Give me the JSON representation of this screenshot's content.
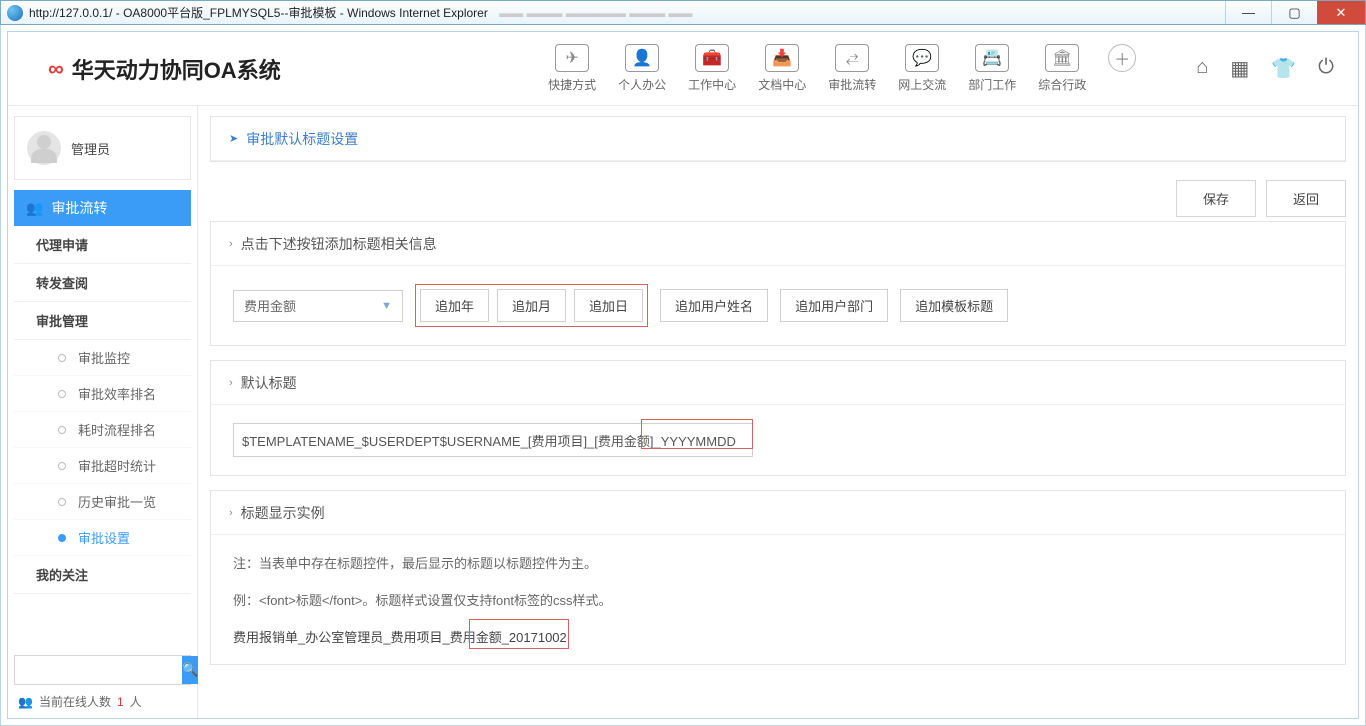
{
  "window": {
    "url": "http://127.0.0.1/",
    "title_suffix": " - OA8000平台版_FPLMYSQL5--审批模板 - Windows Internet Explorer"
  },
  "brand": {
    "name": "华天动力协同OA系统"
  },
  "nav": [
    {
      "label": "快捷方式",
      "glyph": "✈"
    },
    {
      "label": "个人办公",
      "glyph": "👤"
    },
    {
      "label": "工作中心",
      "glyph": "🧰"
    },
    {
      "label": "文档中心",
      "glyph": "📥"
    },
    {
      "label": "审批流转",
      "glyph": "⥄"
    },
    {
      "label": "网上交流",
      "glyph": "💬"
    },
    {
      "label": "部门工作",
      "glyph": "📇"
    },
    {
      "label": "综合行政",
      "glyph": "🏛"
    }
  ],
  "sidebar": {
    "user": "管理员",
    "head": "审批流转",
    "links": [
      "代理申请",
      "转发查阅",
      "审批管理"
    ],
    "subs": [
      "审批监控",
      "审批效率排名",
      "耗时流程排名",
      "审批超时统计",
      "历史审批一览",
      "审批设置"
    ],
    "active_sub_index": 5,
    "concern": "我的关注",
    "online_label": "当前在线人数 ",
    "online_count": "1",
    "online_unit": "人"
  },
  "main": {
    "page_title": "审批默认标题设置",
    "buttons": {
      "save": "保存",
      "back": "返回"
    },
    "section_add": "点击下述按钮添加标题相关信息",
    "select_value": "费用金额",
    "add_btns": [
      "追加年",
      "追加月",
      "追加日"
    ],
    "add_btns2": [
      "追加用户姓名",
      "追加用户部门",
      "追加模板标题"
    ],
    "section_default": "默认标题",
    "title_value": "$TEMPLATENAME_$USERDEPT$USERNAME_[费用项目]_[费用金额]_YYYYMMDD",
    "section_example": "标题显示实例",
    "note1": "注：当表单中存在标题控件，最后显示的标题以标题控件为主。",
    "note2": "例：<font>标题</font>。标题样式设置仅支持font标签的css样式。",
    "example": "费用报销单_办公室管理员_费用项目_费用金额_20171002"
  }
}
